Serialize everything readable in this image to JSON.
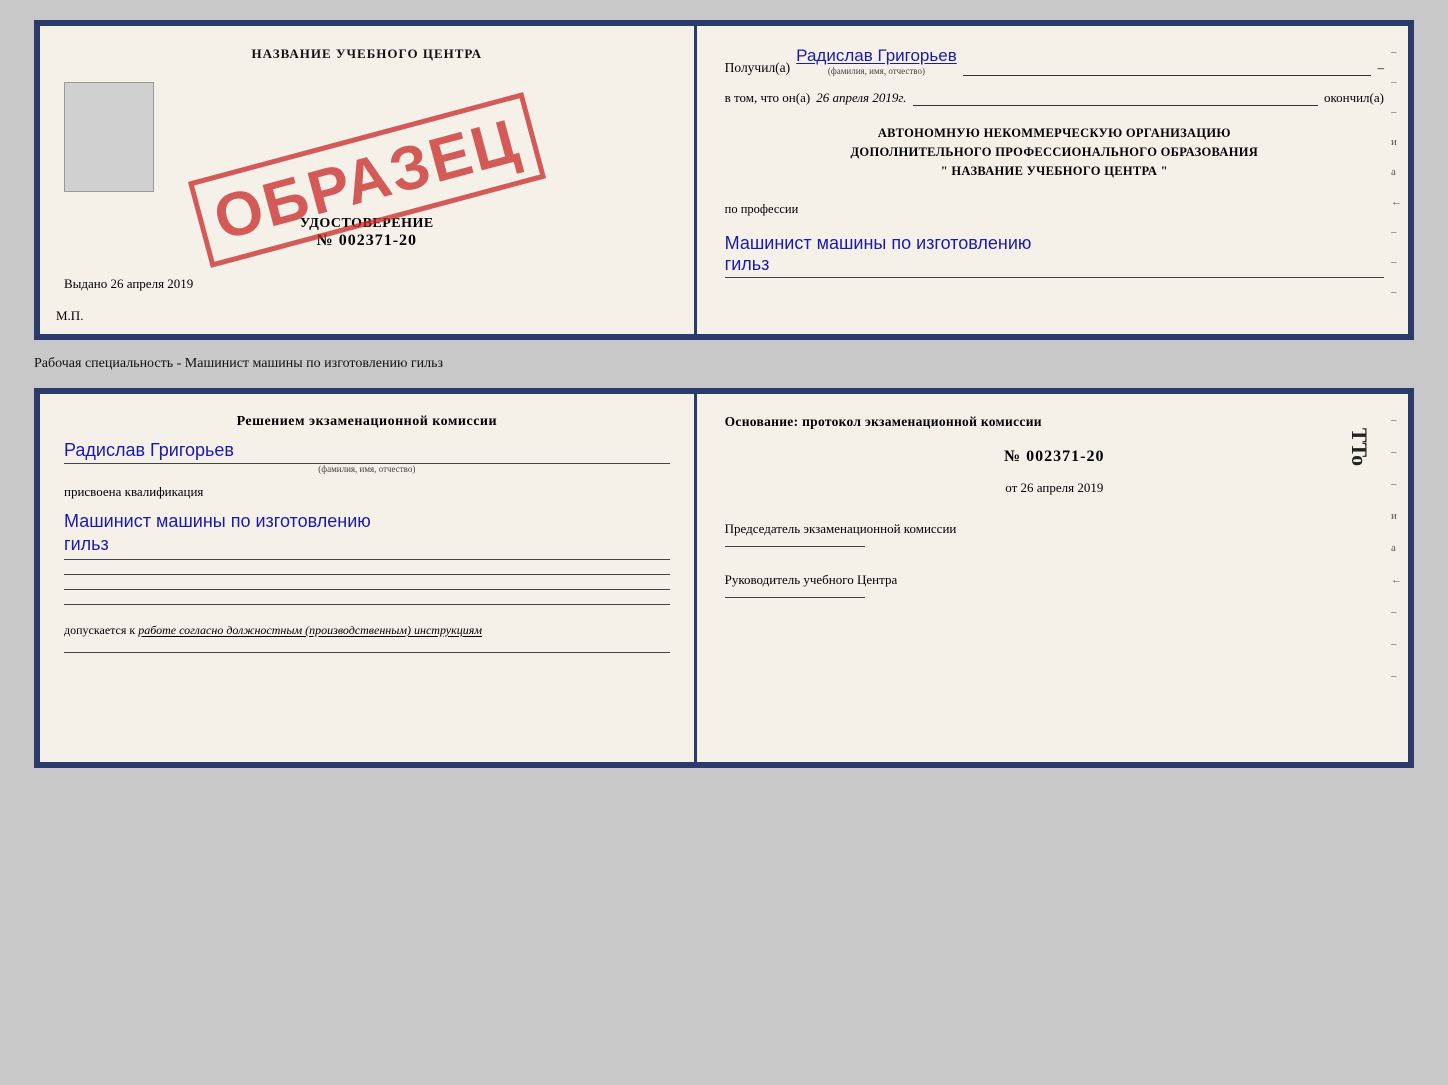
{
  "top_cert": {
    "left": {
      "title": "НАЗВАНИЕ УЧЕБНОГО ЦЕНТРА",
      "stamp_text": "ОБРАЗЕЦ",
      "udostoverenie_label": "УДОСТОВЕРЕНИЕ",
      "number": "№ 002371-20",
      "vydano_label": "Выдано",
      "vydano_date": "26 апреля 2019",
      "mp": "М.П."
    },
    "right": {
      "poluchil_label": "Получил(а)",
      "name": "Радислав Григорьев",
      "name_sub": "(фамилия, имя, отчество)",
      "vtom_label": "в том, что он(а)",
      "date": "26 апреля 2019г.",
      "okonchil_label": "окончил(а)",
      "org_line1": "АВТОНОМНУЮ НЕКОММЕРЧЕСКУЮ ОРГАНИЗАЦИЮ",
      "org_line2": "ДОПОЛНИТЕЛЬНОГО ПРОФЕССИОНАЛЬНОГО ОБРАЗОВАНИЯ",
      "org_name": "НАЗВАНИЕ УЧЕБНОГО ЦЕНТРА",
      "po_professii": "по профессии",
      "profession": "Машинист машины по изготовлению",
      "profession2": "гильз",
      "dashes": [
        "-",
        "-",
        "-",
        "и",
        "а",
        "←",
        "-",
        "-",
        "-"
      ]
    }
  },
  "bottom_label": "Рабочая специальность - Машинист машины по изготовлению гильз",
  "bottom_cert": {
    "left": {
      "resheniem": "Решением  экзаменационной  комиссии",
      "name": "Радислав Григорьев",
      "name_sub": "(фамилия, имя, отчество)",
      "prisvoyena": "присвоена квалификация",
      "profession": "Машинист машины по изготовлению",
      "profession2": "гильз",
      "dopuskaetsya_label": "допускается к",
      "dopuskaetsya_text": "работе согласно должностным (производственным) инструкциям"
    },
    "right": {
      "osnovanie": "Основание: протокол экзаменационной  комиссии",
      "number": "№  002371-20",
      "ot_label": "от",
      "date": "26 апреля 2019",
      "predsedatel_label": "Председатель экзаменационной комиссии",
      "rukovoditel_label": "Руководитель учебного Центра",
      "tto": "TTo",
      "dashes": [
        "-",
        "-",
        "-",
        "и",
        "а",
        "←",
        "-",
        "-",
        "-"
      ]
    }
  }
}
